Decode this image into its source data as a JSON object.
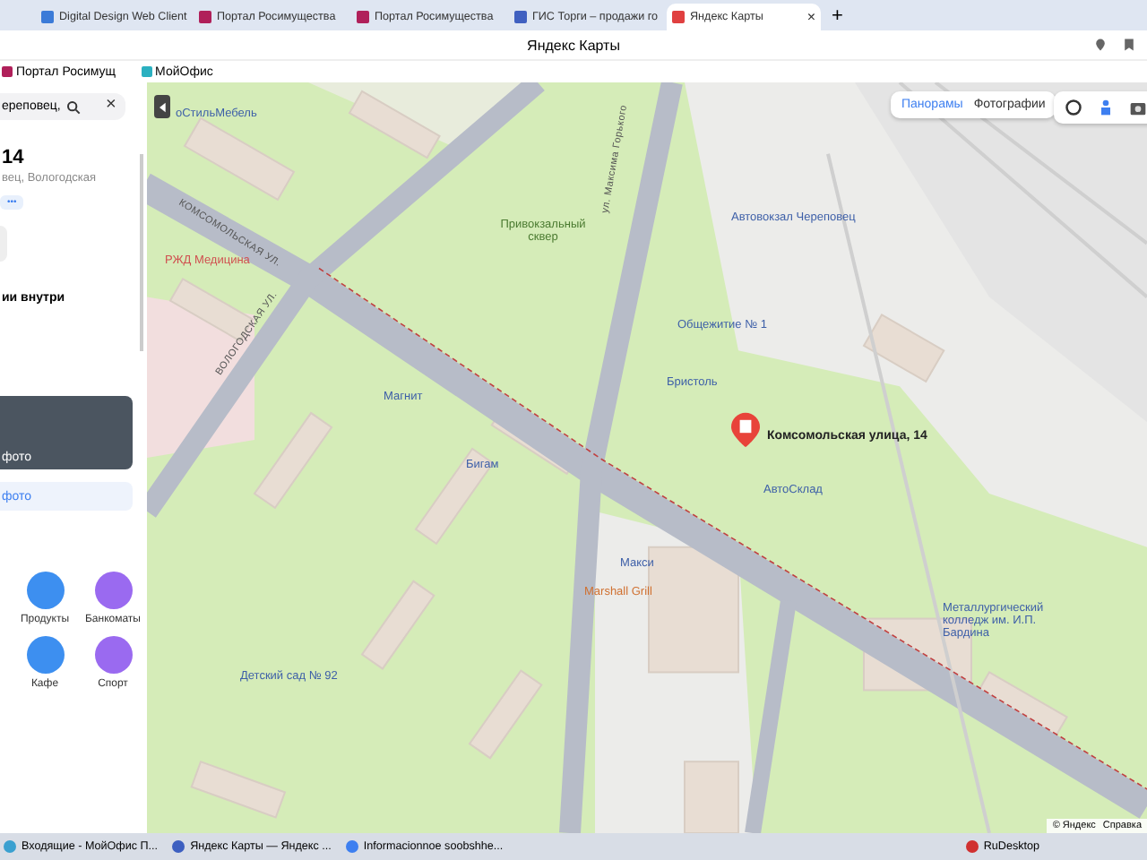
{
  "browser": {
    "tabs": [
      {
        "label": "Digital Design Web Client",
        "selected": false
      },
      {
        "label": "Портал Росимущества",
        "selected": false
      },
      {
        "label": "Портал Росимущества",
        "selected": false
      },
      {
        "label": "ГИС Торги – продажи го",
        "selected": false
      },
      {
        "label": "Яндекс Карты",
        "selected": true
      }
    ],
    "new_tab": "+",
    "close": "×",
    "title": "Яндекс Карты",
    "bookmarks": [
      "Портал Росимущ",
      "МойОфис"
    ]
  },
  "panel": {
    "search_value": "ереповец,",
    "close": "×",
    "title": "14",
    "address": "вец, Вологодская",
    "chip": "•••",
    "section": "ии внутри",
    "photo_caption": "фото",
    "photo_link": "фото",
    "categories": [
      {
        "label": "Продукты",
        "color": "#3d8ff0"
      },
      {
        "label": "Банкоматы",
        "color": "#9a6af0"
      },
      {
        "label": "Кафе",
        "color": "#3d8ff0"
      },
      {
        "label": "Спорт",
        "color": "#9a6af0"
      }
    ]
  },
  "map": {
    "layer_tabs": [
      {
        "label": "Панорамы",
        "selected": true
      },
      {
        "label": "Фотографии",
        "selected": false
      }
    ],
    "labels": [
      {
        "text": "оСтильМебель",
        "kind": "poi"
      },
      {
        "text": "КОМСОМОЛЬСКАЯ УЛ.",
        "kind": "street"
      },
      {
        "text": "ВОЛОГОДСКАЯ УЛ.",
        "kind": "street"
      },
      {
        "text": "РЖД Медицина",
        "kind": "medical"
      },
      {
        "text": "Привокзальный сквер",
        "kind": "park"
      },
      {
        "text": "ул. Максима Горького",
        "kind": "street"
      },
      {
        "text": "Магнит",
        "kind": "poi"
      },
      {
        "text": "Бигам",
        "kind": "poi"
      },
      {
        "text": "Автовокзал Череповец",
        "kind": "poi"
      },
      {
        "text": "Общежитие № 1",
        "kind": "poi"
      },
      {
        "text": "Бристоль",
        "kind": "poi"
      },
      {
        "text": "Комсомольская улица, 14",
        "kind": "address"
      },
      {
        "text": "АвтоСклад",
        "kind": "poi"
      },
      {
        "text": "Макси",
        "kind": "poi"
      },
      {
        "text": "Marshall Grill",
        "kind": "food"
      },
      {
        "text": "Детский сад № 92",
        "kind": "poi"
      },
      {
        "text": "Металлургический колледж им. И.П. Бардина",
        "kind": "poi"
      }
    ],
    "footer": [
      "© Яндекс",
      "Справка"
    ]
  },
  "taskbar": {
    "items": [
      "Входящие - МойОфис П...",
      "Яндекс Карты — Яндекс ...",
      "Informacionnoe soobshhe...",
      "RuDesktop"
    ]
  }
}
